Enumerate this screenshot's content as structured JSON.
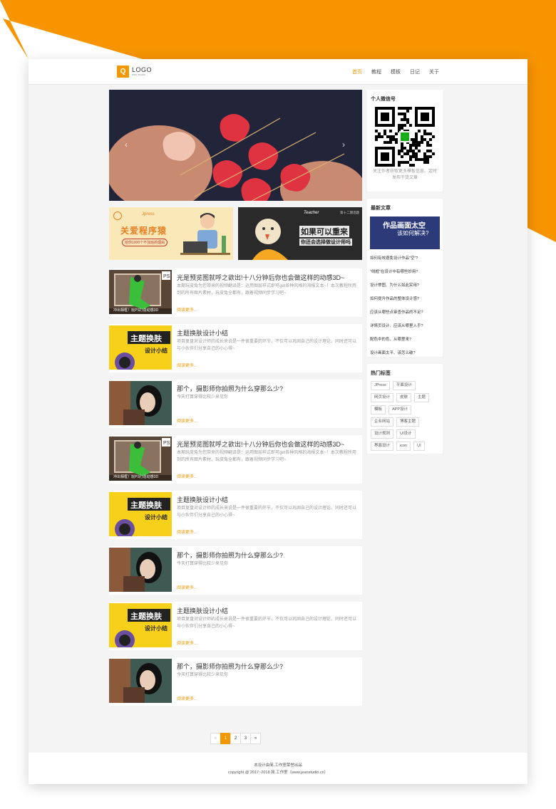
{
  "colors": {
    "accent": "#f39800",
    "bg": "#f4f4f4"
  },
  "header": {
    "logo_icon": "Q",
    "logo_text": "LOGO",
    "logo_sub": "web studio",
    "nav": [
      "首页",
      "教程",
      "模板",
      "日记",
      "关于"
    ]
  },
  "slider": {
    "prev": "‹",
    "next": "›"
  },
  "banners": {
    "left": {
      "small": "Jpress",
      "title": "关爱程序猿",
      "button": "给你1000个不加班的理由"
    },
    "right": {
      "tag": "Teacher",
      "corner": "第十二期话题",
      "line1": "如果可以重来",
      "line2": "你还会选择做设计师吗"
    }
  },
  "articles": [
    {
      "title": "光是预览图就呼之欲出!十八分钟后你也会做这样的动感3D~",
      "desc": "本期玩皮兔为您带来的视频翻译是：运用图层样式即可get各种风格的海报文本~！本次教程所用到的所有图片素材，玩皮兔全都有，跟着视频同步学习吧~",
      "more": "阅读更多...",
      "thumb": "3d",
      "caption": "冲出相框！玩PS打造动感3D"
    },
    {
      "title": "主题换肤设计小结",
      "desc": "项目复盘对设计师的成长来说是一件很重要的环节，不仅可以巩固自己的设计理论，同时还可以与小伙伴们分享自己的小心得~",
      "more": "阅读更多...",
      "thumb": "theme",
      "caption1": "主题换肤",
      "caption2": "设计小结"
    },
    {
      "title": "那个，摄影师你拍照为什么穿那么少?",
      "desc": "今天打算穿得比较少来见你",
      "more": "阅读更多...",
      "thumb": "photo"
    },
    {
      "title": "光是预览图就呼之欲出!十八分钟后你也会做这样的动感3D~",
      "desc": "本期玩皮兔为您带来的视频翻译是：运用图层样式即可get各种风格的海报文本~！本次教程所用到的所有图片素材，玩皮兔全都有，跟着视频同步学习吧~",
      "more": "阅读更多...",
      "thumb": "3d",
      "caption": "冲出相框！玩PS打造动感3D"
    },
    {
      "title": "主题换肤设计小结",
      "desc": "项目复盘对设计师的成长来说是一件很重要的环节，不仅可以巩固自己的设计理论，同时还可以与小伙伴们分享自己的小心得~",
      "more": "阅读更多...",
      "thumb": "theme",
      "caption1": "主题换肤",
      "caption2": "设计小结"
    },
    {
      "title": "那个，摄影师你拍照为什么穿那么少?",
      "desc": "今天打算穿得比较少来见你",
      "more": "阅读更多...",
      "thumb": "photo"
    },
    {
      "title": "主题换肤设计小结",
      "desc": "项目复盘对设计师的成长来说是一件很重要的环节，不仅可以巩固自己的设计理论，同时还可以与小伙伴们分享自己的小心得~",
      "more": "阅读更多...",
      "thumb": "theme",
      "caption1": "主题换肤",
      "caption2": "设计小结"
    },
    {
      "title": "那个，摄影师你拍照为什么穿那么少?",
      "desc": "今天打算穿得比较少来见你",
      "more": "阅读更多...",
      "thumb": "photo"
    }
  ],
  "pager": [
    "«",
    "1",
    "2",
    "3",
    "»"
  ],
  "sidebar": {
    "wechat": {
      "title": "个人微信号",
      "caption": "关注作者获取更多模板信息、定时发布干货文章"
    },
    "latest": {
      "title": "最新文章",
      "banner_line1": "作品画面太空",
      "banner_line2": "该如何解决?",
      "items": [
        "如何有效避免设计作品\"空\"?",
        "\"线框\"在设计中有哪些妙用?",
        "设计惨图、为什么如此实用?",
        "如何提升作品的整体设计感?",
        "应该从哪些点审查作品的不足?",
        "详情页设计、应该从哪里入手?",
        "配色中的色、从哪里来?",
        "设计画面太平、该怎么破?"
      ]
    },
    "tags": {
      "title": "热门标签",
      "items": [
        "JPress",
        "平面设计",
        "网页设计",
        "皮肤",
        "主题",
        "模板",
        "APP设计",
        "企业网站",
        "博客主题",
        "设计规则",
        "UI设计",
        "界面设计",
        "icon",
        "UI"
      ]
    }
  },
  "footer": {
    "line1": "本设计由简.工作室荣誉出品",
    "line2": "copyright @ 2017~2018 简.工作室（www.jeanstudio.cn）"
  }
}
